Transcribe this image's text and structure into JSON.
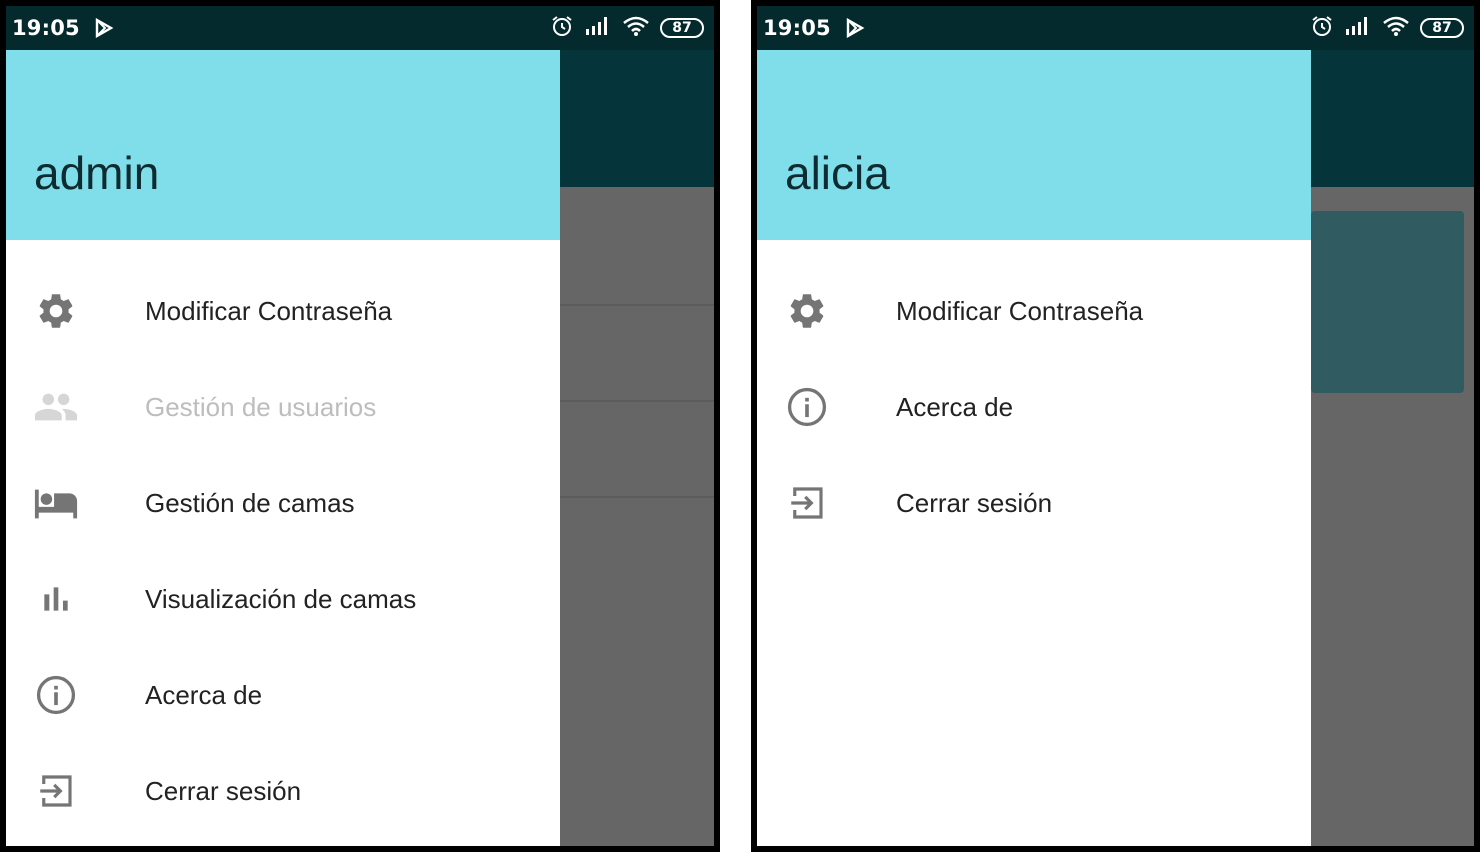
{
  "screens": [
    {
      "status_bar": {
        "time": "19:05",
        "battery": "87"
      },
      "drawer": {
        "username": "admin",
        "menu": [
          {
            "label": "Modificar Contraseña",
            "icon": "gear-icon",
            "enabled": true
          },
          {
            "label": "Gestión de usuarios",
            "icon": "people-icon",
            "enabled": false
          },
          {
            "label": "Gestión de camas",
            "icon": "bed-icon",
            "enabled": true
          },
          {
            "label": "Visualización de camas",
            "icon": "bar-chart-icon",
            "enabled": true
          },
          {
            "label": "Acerca de",
            "icon": "info-icon",
            "enabled": true
          },
          {
            "label": "Cerrar sesión",
            "icon": "logout-icon",
            "enabled": true
          }
        ]
      }
    },
    {
      "status_bar": {
        "time": "19:05",
        "battery": "87"
      },
      "drawer": {
        "username": "alicia",
        "menu": [
          {
            "label": "Modificar Contraseña",
            "icon": "gear-icon",
            "enabled": true
          },
          {
            "label": "Acerca de",
            "icon": "info-icon",
            "enabled": true
          },
          {
            "label": "Cerrar sesión",
            "icon": "logout-icon",
            "enabled": true
          }
        ]
      }
    }
  ],
  "colors": {
    "header": "#80deea",
    "status_bar": "#052a2d",
    "app_bar": "#05353a",
    "scrim": "#666666",
    "icon": "#757575",
    "disabled": "#bdbdbd"
  }
}
